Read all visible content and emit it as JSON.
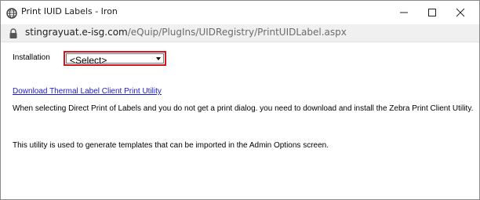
{
  "window": {
    "title": "Print IUID Labels - Iron",
    "controls": {
      "minimize_icon": "minimize-icon",
      "maximize_icon": "maximize-icon",
      "close_icon": "close-icon"
    }
  },
  "address_bar": {
    "domain": "stingrayuat.e-isg.com",
    "path": "/eQuip/PlugIns/UIDRegistry/PrintUIDLabel.aspx",
    "icon": "lock-icon"
  },
  "form": {
    "installation_label": "Installation",
    "installation_select": {
      "selected": "<Select>",
      "highlight_color": "#d0161e"
    }
  },
  "content": {
    "download_link": "Download Thermal Label Client Print Utility",
    "direct_print_note": "When selecting Direct Print of Labels and you do not get a print dialog. you need to download and install the Zebra Print Client Utility.",
    "utility_note": "This utility is used to generate templates that can be imported in the Admin Options screen."
  },
  "colors": {
    "link": "#1a1ad0",
    "address_bar_bg": "#f0f0f0"
  }
}
